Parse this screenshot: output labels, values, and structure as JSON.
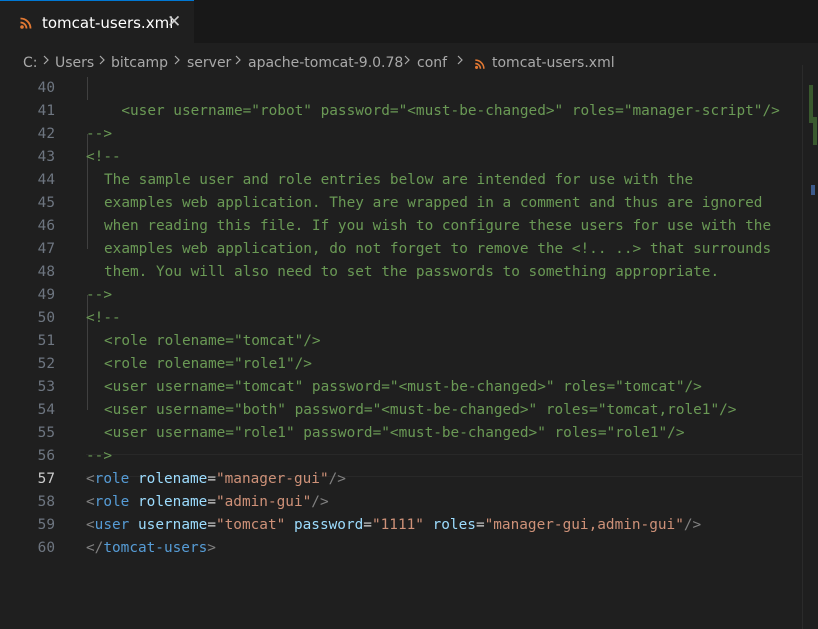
{
  "tab": {
    "title": "tomcat-users.xml",
    "close": "✕",
    "icon": "rss-xml-file-icon"
  },
  "breadcrumb": [
    "C:",
    "Users",
    "bitcamp",
    "server",
    "apache-tomcat-9.0.78",
    "conf",
    "tomcat-users.xml"
  ],
  "editor": {
    "active_line": "57",
    "line_numbers": [
      "40",
      "41",
      "42",
      "43",
      "44",
      "45",
      "46",
      "47",
      "48",
      "49",
      "50",
      "51",
      "52",
      "53",
      "54",
      "55",
      "56",
      "57",
      "58",
      "59",
      "60"
    ],
    "lines": {
      "l40": "  <user username=\"robot\" password=\"<must-be-changed>\" roles=\"manager-script\"/>",
      "l41": "-->",
      "l42": "<!--",
      "l43": "The sample user and role entries below are intended for use with the",
      "l44": "examples web application. They are wrapped in a comment and thus are ignored",
      "l45": "when reading this file. If you wish to configure these users for use with the",
      "l46": "examples web application, do not forget to remove the <!.. ..> that surrounds",
      "l47": "them. You will also need to set the passwords to something appropriate.",
      "l48": "-->",
      "l49": "<!--",
      "l50": "<role rolename=\"tomcat\"/>",
      "l51": "<role rolename=\"role1\"/>",
      "l52": "<user username=\"tomcat\" password=\"<must-be-changed>\" roles=\"tomcat\"/>",
      "l53": "<user username=\"both\" password=\"<must-be-changed>\" roles=\"tomcat,role1\"/>",
      "l54": "<user username=\"role1\" password=\"<must-be-changed>\" roles=\"role1\"/>",
      "l55": "-->",
      "l56": {
        "open": "<",
        "tag": "role",
        "attr": "rolename",
        "eq": "=",
        "val": "\"manager-gui\"",
        "close": "/>"
      },
      "l57": {
        "open": "<",
        "tag": "role",
        "attr": "rolename",
        "eq": "=",
        "val": "\"admin-gui\"",
        "close": "/>"
      },
      "l58": {
        "open": "<",
        "tag": "user",
        "a1": "username",
        "v1": "\"tomcat\"",
        "a2": "password",
        "v2": "\"1111\"",
        "a3": "roles",
        "v3": "\"manager-gui,admin-gui\"",
        "eq": "=",
        "close": "/>"
      },
      "l59": {
        "open": "</",
        "tag": "tomcat-users",
        "close": ">"
      }
    }
  },
  "colors": {
    "comment": "#6a9955",
    "tag": "#569cd6",
    "attribute": "#9cdcfe",
    "string": "#ce9178",
    "bracket": "#808080",
    "background": "#1f1f1f",
    "tab_accent": "#0078d4"
  }
}
